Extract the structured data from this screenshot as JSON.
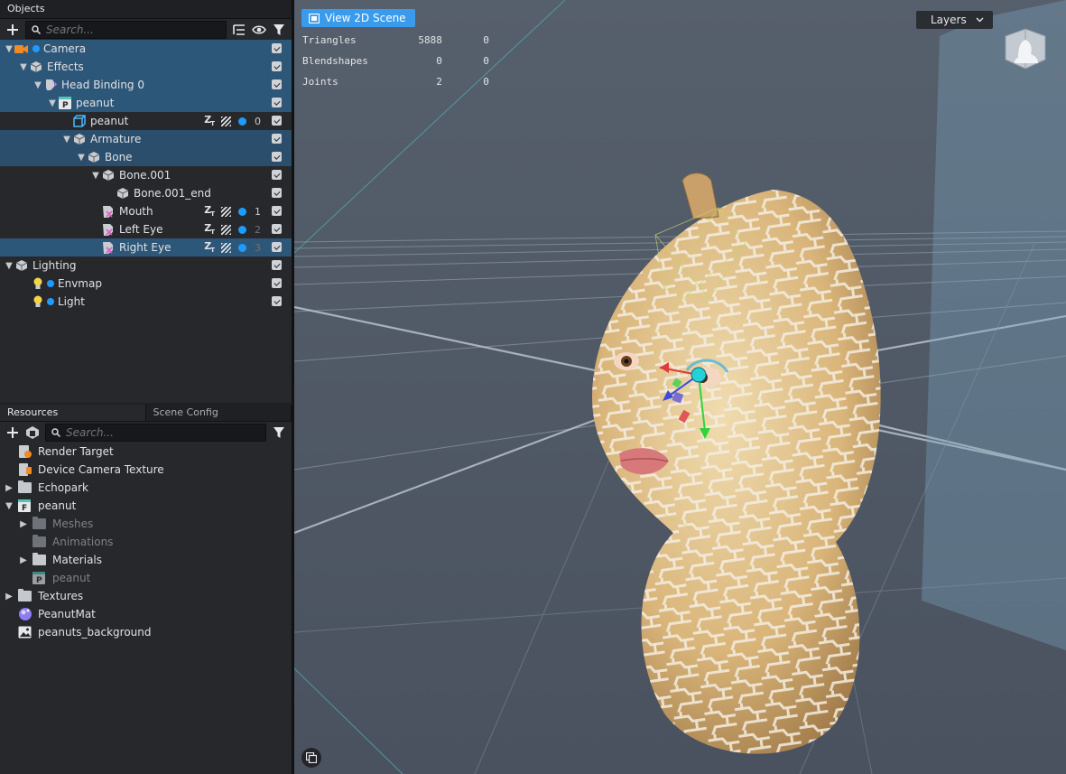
{
  "objects_panel": {
    "title": "Objects",
    "search_placeholder": "Search...",
    "rows": [
      {
        "label": "Camera"
      },
      {
        "label": "Effects"
      },
      {
        "label": "Head Binding 0"
      },
      {
        "label": "peanut"
      },
      {
        "label": "peanut",
        "layer": "0"
      },
      {
        "label": "Armature"
      },
      {
        "label": "Bone"
      },
      {
        "label": "Bone.001"
      },
      {
        "label": "Bone.001_end"
      },
      {
        "label": "Mouth",
        "layer": "1"
      },
      {
        "label": "Left Eye",
        "layer": "2"
      },
      {
        "label": "Right Eye",
        "layer": "3"
      },
      {
        "label": "Lighting"
      },
      {
        "label": "Envmap"
      },
      {
        "label": "Light"
      }
    ]
  },
  "resources_panel": {
    "tab_resources": "Resources",
    "tab_scene_config": "Scene Config",
    "search_placeholder": "Search...",
    "rows": [
      {
        "label": "Render Target"
      },
      {
        "label": "Device Camera Texture"
      },
      {
        "label": "Echopark"
      },
      {
        "label": "peanut"
      },
      {
        "label": "Meshes"
      },
      {
        "label": "Animations"
      },
      {
        "label": "Materials"
      },
      {
        "label": "peanut"
      },
      {
        "label": "Textures"
      },
      {
        "label": "PeanutMat"
      },
      {
        "label": "peanuts_background"
      }
    ]
  },
  "viewport": {
    "view2d_label": "View 2D Scene",
    "layers_label": "Layers",
    "stats": [
      {
        "name": "Triangles",
        "v1": "5888",
        "v2": "0"
      },
      {
        "name": "Blendshapes",
        "v1": "0",
        "v2": "0"
      },
      {
        "name": "Joints",
        "v1": "2",
        "v2": "0"
      }
    ]
  },
  "colors": {
    "selection": "#2d5779",
    "accent": "#3a9bec",
    "dot": "#1f9bff"
  }
}
